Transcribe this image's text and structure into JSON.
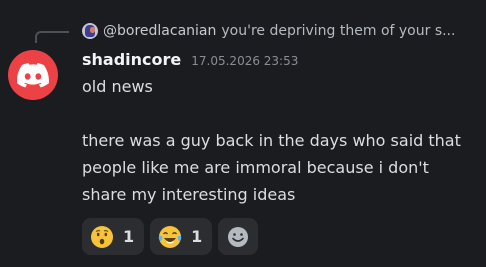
{
  "reply": {
    "author": "@boredlacanian",
    "text": "you're depriving them of your s..."
  },
  "message": {
    "username": "shadincore",
    "timestamp": "17.05.2026 23:53",
    "lines": [
      "old news",
      "",
      "there was a guy back in the days who said that",
      "people like me are immoral because i don't",
      "share my interesting ideas"
    ]
  },
  "reactions": [
    {
      "emoji": "hushed-face",
      "count": "1"
    },
    {
      "emoji": "tears-of-joy-face",
      "count": "1"
    }
  ],
  "colors": {
    "background": "#1b1c20",
    "avatar": "#ed4245",
    "reaction_bg": "#2b2d31"
  }
}
